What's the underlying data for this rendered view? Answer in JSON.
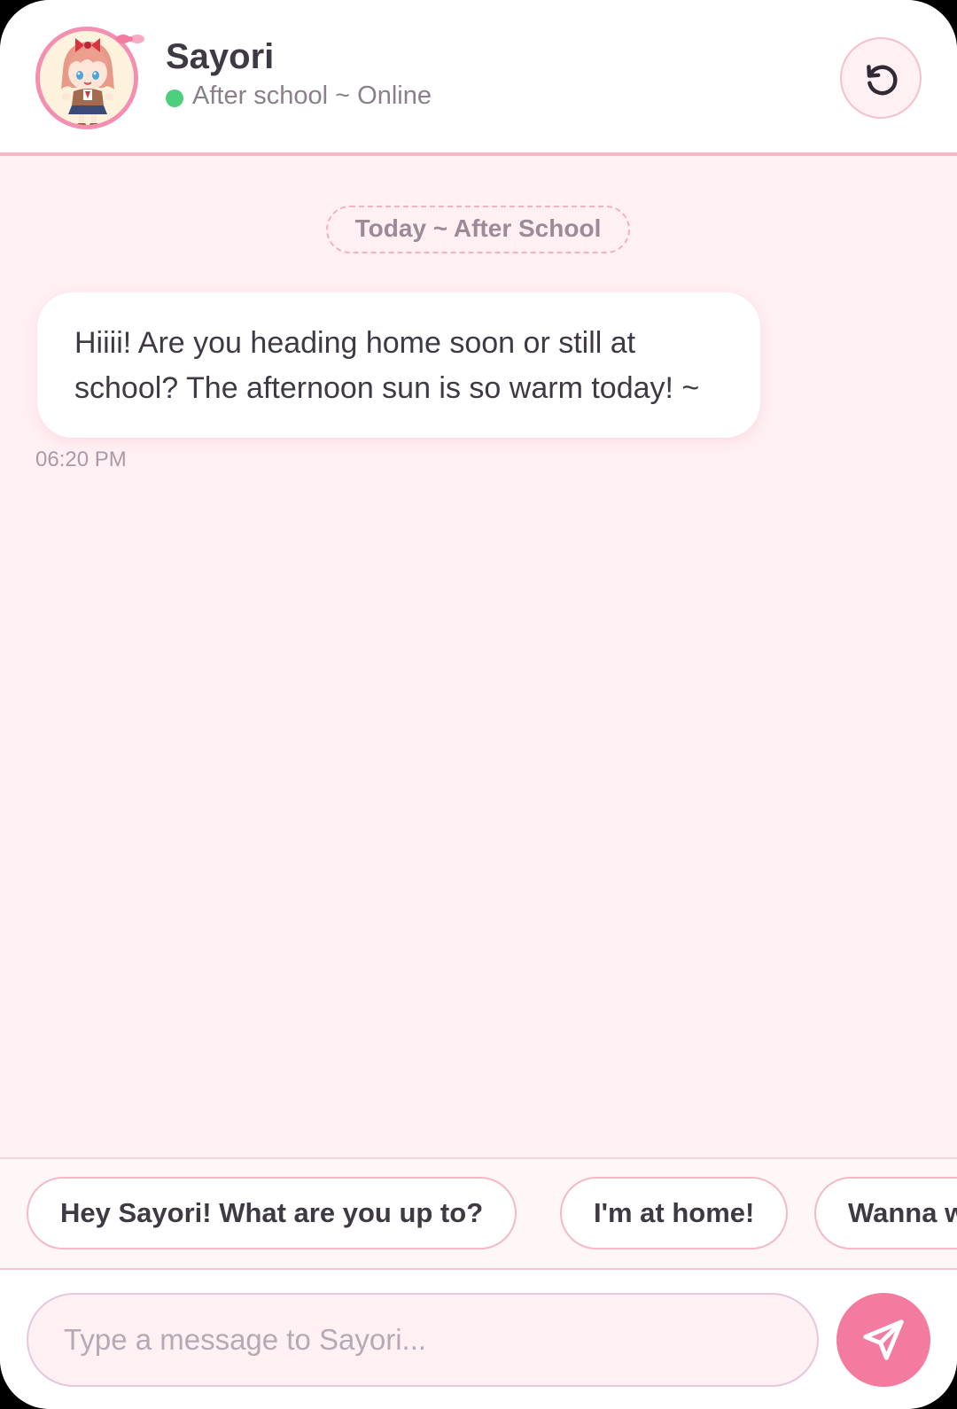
{
  "header": {
    "contact_name": "Sayori",
    "status_text": "After school ~ Online",
    "status_color": "#4cd07d",
    "avatar_icon": "chibi-girl-avatar",
    "reset_icon": "rotate-ccw-icon"
  },
  "chat": {
    "date_divider": "Today ~ After School",
    "messages": [
      {
        "sender": "Sayori",
        "text": "Hiiii! Are you heading home soon or still at school? The afternoon sun is so warm today! ~",
        "time": "06:20 PM"
      }
    ]
  },
  "suggestions": [
    "Hey Sayori! What are you up to?",
    "I'm at home!",
    "Wanna w"
  ],
  "composer": {
    "placeholder": "Type a message to Sayori...",
    "value": "",
    "send_icon": "send-icon"
  },
  "colors": {
    "accent": "#f47ba0",
    "background": "#fff0f4",
    "border": "#f4b8c6"
  }
}
